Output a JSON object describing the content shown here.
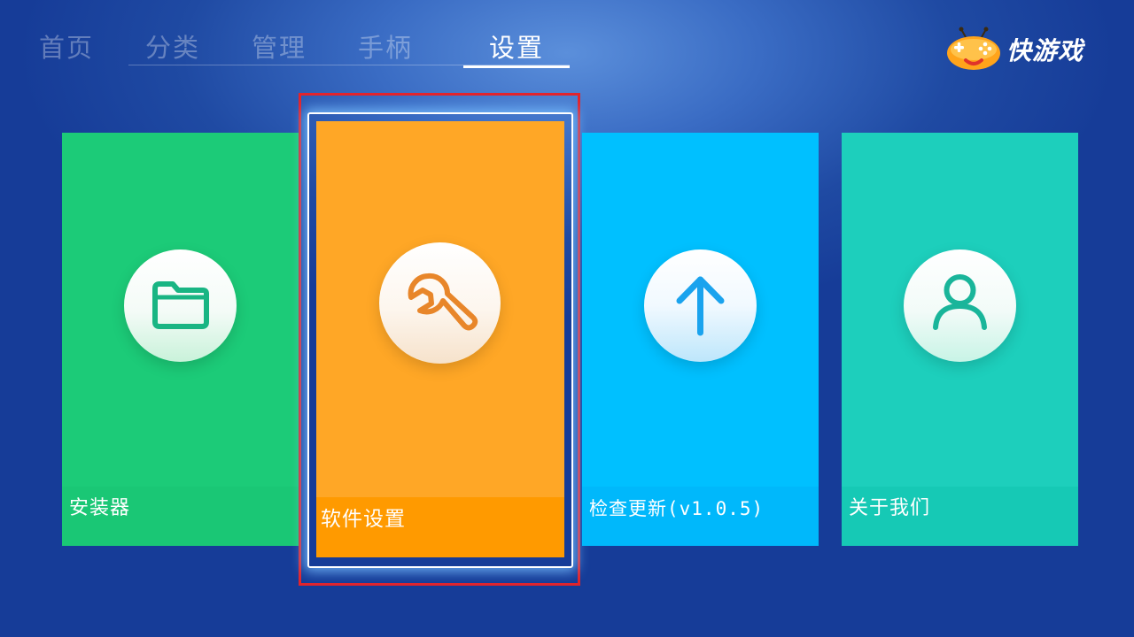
{
  "nav": {
    "tabs": [
      {
        "label": "首页",
        "active": false
      },
      {
        "label": "分类",
        "active": false
      },
      {
        "label": "管理",
        "active": false
      },
      {
        "label": "手柄",
        "active": false
      },
      {
        "label": "设置",
        "active": true
      }
    ]
  },
  "logo": {
    "text": "快游戏",
    "icon": "gamepad-mascot-icon"
  },
  "cards": [
    {
      "label": "安装器",
      "icon": "folder-icon",
      "color": "#1ccb78"
    },
    {
      "label": "软件设置",
      "icon": "wrench-icon",
      "color": "#ffa726",
      "focused": true
    },
    {
      "label": "检查更新(v1.0.5)",
      "icon": "arrow-up-icon",
      "color": "#00c0ff"
    },
    {
      "label": "关于我们",
      "icon": "user-icon",
      "color": "#1dcfbc"
    }
  ],
  "colors": {
    "background": "#1f4aa3",
    "focus_highlight": "#e2242c",
    "icon_green": "#19b583",
    "icon_orange": "#e8862a",
    "icon_blue": "#1aa3ee",
    "icon_teal": "#19b59a"
  }
}
